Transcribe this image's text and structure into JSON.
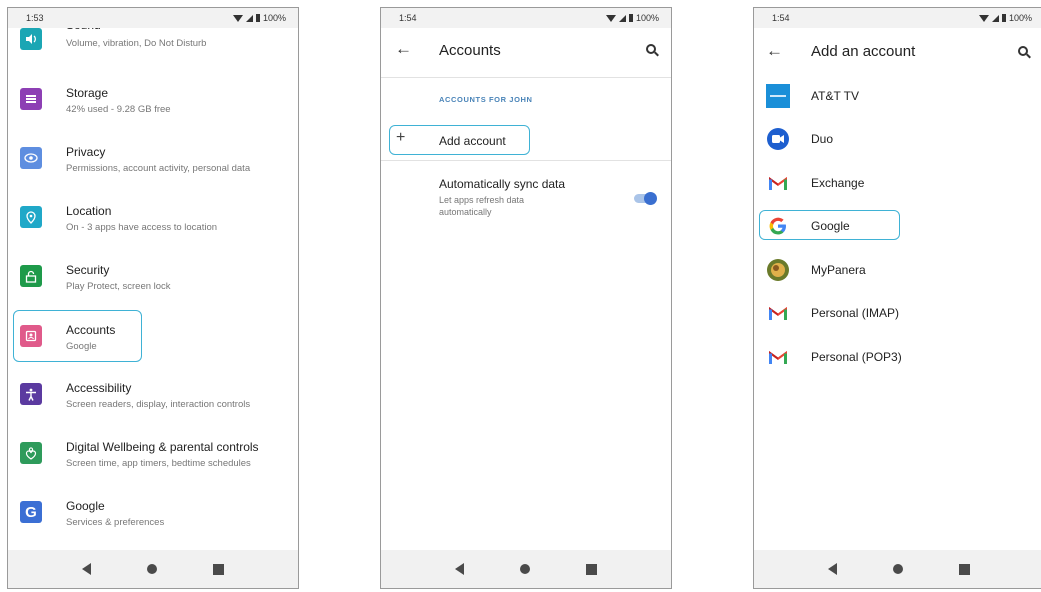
{
  "phones": {
    "settings": {
      "time": "1:53",
      "battery": "100%",
      "items": [
        {
          "title": "Sound",
          "subtitle": "Volume, vibration, Do Not Disturb",
          "icon": "volume-icon",
          "color": "#1ba6b4"
        },
        {
          "title": "Storage",
          "subtitle": "42% used - 9.28 GB free",
          "icon": "storage-icon",
          "color": "#8d3fb4"
        },
        {
          "title": "Privacy",
          "subtitle": "Permissions, account activity, personal data",
          "icon": "privacy-icon",
          "color": "#5e8ee0"
        },
        {
          "title": "Location",
          "subtitle": "On - 3 apps have access to location",
          "icon": "location-icon",
          "color": "#20a8c8"
        },
        {
          "title": "Security",
          "subtitle": "Play Protect, screen lock",
          "icon": "lock-icon",
          "color": "#1e9a4a"
        },
        {
          "title": "Accounts",
          "subtitle": "Google",
          "icon": "accounts-icon",
          "color": "#e05a8a"
        },
        {
          "title": "Accessibility",
          "subtitle": "Screen readers, display, interaction controls",
          "icon": "accessibility-icon",
          "color": "#5b3aa0"
        },
        {
          "title": "Digital Wellbeing & parental controls",
          "subtitle": "Screen time, app timers, bedtime schedules",
          "icon": "wellbeing-icon",
          "color": "#2e9b5b"
        },
        {
          "title": "Google",
          "subtitle": "Services & preferences",
          "icon": "google-icon",
          "color": "#3b6fd4"
        }
      ]
    },
    "accounts": {
      "time": "1:54",
      "battery": "100%",
      "title": "Accounts",
      "section_label": "ACCOUNTS FOR JOHN",
      "add_account": "Add account",
      "sync_title": "Automatically sync data",
      "sync_subtitle_line1": "Let apps refresh data",
      "sync_subtitle_line2": "automatically",
      "sync_enabled": true
    },
    "add_account": {
      "time": "1:54",
      "battery": "100%",
      "title": "Add an account",
      "items": [
        {
          "label": "AT&T TV",
          "icon": "att-tv-icon"
        },
        {
          "label": "Duo",
          "icon": "duo-icon"
        },
        {
          "label": "Exchange",
          "icon": "gmail-icon"
        },
        {
          "label": "Google",
          "icon": "google-g-icon"
        },
        {
          "label": "MyPanera",
          "icon": "panera-icon"
        },
        {
          "label": "Personal (IMAP)",
          "icon": "gmail-icon"
        },
        {
          "label": "Personal (POP3)",
          "icon": "gmail-icon"
        }
      ]
    }
  },
  "highlight_color": "#3fb2d5",
  "accent_color": "#3a6fd0"
}
